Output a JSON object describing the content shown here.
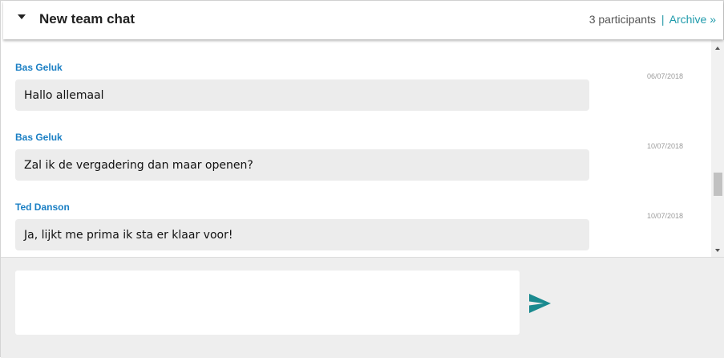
{
  "header": {
    "title": "New team chat",
    "participants": "3 participants",
    "separator": "|",
    "archive_label": "Archive »"
  },
  "messages": [
    {
      "sender": "Bas Geluk",
      "date": "06/07/2018",
      "text": "Hallo allemaal"
    },
    {
      "sender": "Bas Geluk",
      "date": "10/07/2018",
      "text": "Zal ik de vergadering dan maar openen?"
    },
    {
      "sender": "Ted Danson",
      "date": "10/07/2018",
      "text": "Ja, lijkt me prima ik sta er klaar voor!"
    }
  ],
  "composer": {
    "value": "",
    "placeholder": ""
  },
  "colors": {
    "accent": "#1e9aab",
    "sender": "#1a7fc4",
    "send_icon": "#1a8a8f",
    "bubble": "#ececec"
  },
  "icons": {
    "collapse": "caret-down-icon",
    "send": "paper-plane-icon"
  }
}
